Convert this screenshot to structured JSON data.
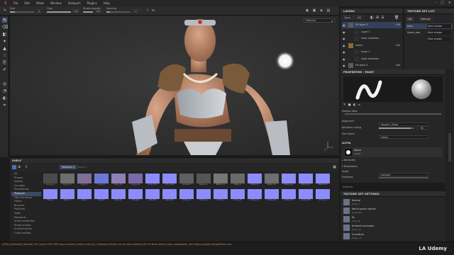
{
  "menu": {
    "items": [
      "File",
      "Edit",
      "Mode",
      "Window",
      "Viewport",
      "Plugins",
      "Help"
    ]
  },
  "toolbar": {
    "size_label": "Size",
    "size_value": "10",
    "size_fill": 0.2,
    "flow_label": "Flow",
    "flow_value": "100",
    "flow_fill": 1.0,
    "stroke_opacity_label": "Stroke opacity",
    "stroke_opacity_value": "100",
    "stroke_opacity_fill": 1.0,
    "spacing_label": "Spacing",
    "spacing_value": "15",
    "spacing_fill": 0.15
  },
  "viewport": {
    "material_mode": "Material"
  },
  "layers": {
    "title": "LAYERS",
    "blend_mode": "Norm",
    "opacity": "100",
    "rows": [
      {
        "name": "Fill layer 3",
        "value": "100"
      },
      {
        "name": "Layer 2",
        "value": ""
      },
      {
        "name": "Color selection",
        "value": ""
      },
      {
        "name": "metal",
        "value": "100"
      },
      {
        "name": "Layer 1",
        "value": ""
      },
      {
        "name": "Color selection",
        "value": ""
      },
      {
        "name": "Fill layer 3",
        "value": "100"
      }
    ]
  },
  "texture_set_list": {
    "title": "TEXTURE SET LIST",
    "tabs": [
      "All",
      "Settings"
    ],
    "rows": [
      {
        "name": "body",
        "shader": "Main shader"
      },
      {
        "name": "Sword_mat",
        "shader": "Main shader"
      },
      {
        "name": "",
        "shader": "Main shader"
      }
    ]
  },
  "properties": {
    "title": "PROPERTIES - PAINT",
    "position_jitter_label": "Position Jitter",
    "alignment_label": "Alignment",
    "alignment_value": "Tangent | Wrap",
    "backface_label": "Backface culling",
    "backface_value": "90",
    "backface_fill": 0.9,
    "size_space_label": "Size Space",
    "size_space_value": "Object",
    "alpha_section": "ALPHA",
    "alpha_name": "Alpha",
    "alpha_sub": "Shape",
    "attributes_label": "Attributes",
    "parameters_label": "Parameters",
    "angle_label": "Angle",
    "angle_value": "Isotropic",
    "hardness_label": "Hardness"
  },
  "tset_settings": {
    "title_small": "Uniforms",
    "title": "TEXTURE SET SETTINGS",
    "rows": [
      {
        "name": "Normal",
        "file": "body_d"
      },
      {
        "name": "World space normal",
        "file": "body_Wm"
      },
      {
        "name": "ID",
        "file": "body_ID"
      },
      {
        "name": "Ambient occlusion",
        "file": "body_ao"
      },
      {
        "name": "Curvature",
        "file": "body_cur"
      }
    ]
  },
  "shelf": {
    "title": "SHELF",
    "filter_chip": "Textures",
    "search_placeholder": "Search...",
    "categories": [
      "All",
      "Project",
      "Alphas",
      "Grunges",
      "Procedurals",
      "Textures",
      "Hard Surfaces",
      "Filters",
      "Brushes",
      "Particles",
      "Tools",
      "Materials",
      "Smart materials",
      "Smart masks",
      "Environments",
      "Color profiles"
    ],
    "selected_category": 5,
    "row1": [
      {
        "label": "body_ao",
        "color": "#4a4a4a"
      },
      {
        "label": "body_cur",
        "color": "#6e6e6e"
      },
      {
        "label": "body_d",
        "color": "#7f6f9a"
      },
      {
        "label": "body_ID",
        "color": "#6b78d8"
      },
      {
        "label": "body_nm",
        "color": "#8f7fb5"
      },
      {
        "label": "body_pos",
        "color": "#7a6aa8"
      },
      {
        "label": "body_Wm",
        "color": "#8c8cff"
      },
      {
        "label": "dirt_mask",
        "color": "#8c8cff"
      },
      {
        "label": "Gradient",
        "color": "#5f5f5f"
      },
      {
        "label": "Metal_ao",
        "color": "#555"
      },
      {
        "label": "Metal_cur",
        "color": "#777"
      },
      {
        "label": "Metal_d",
        "color": "#6a6a6a"
      },
      {
        "label": "Metal_ID",
        "color": "#8c8cff"
      },
      {
        "label": "Metal_nm",
        "color": "#6f6f6f"
      },
      {
        "label": "Metal_pos",
        "color": "#8c8cff"
      },
      {
        "label": "Metal_Wm",
        "color": "#8c8cff"
      },
      {
        "label": "Metal_thk",
        "color": "#8c8cff"
      }
    ],
    "row2": [
      {
        "label": "belt_ao",
        "color": "#8c8cff"
      },
      {
        "label": "belt_cur",
        "color": "#8c8cff"
      },
      {
        "label": "belt_d",
        "color": "#8c8cff"
      },
      {
        "label": "belt_ID",
        "color": "#8c8cff"
      },
      {
        "label": "belt_nm",
        "color": "#8c8cff"
      },
      {
        "label": "belt_pos",
        "color": "#8c8cff"
      },
      {
        "label": "belt_thk",
        "color": "#8c8cff"
      },
      {
        "label": "belt_Wm",
        "color": "#8c8cff"
      },
      {
        "label": "boots_ao",
        "color": "#8c8cff"
      },
      {
        "label": "boots_cur",
        "color": "#8c8cff"
      },
      {
        "label": "boots_d",
        "color": "#8c8cff"
      },
      {
        "label": "boots_ID",
        "color": "#8c8cff"
      },
      {
        "label": "boots_nm",
        "color": "#8c8cff"
      },
      {
        "label": "boots_pos",
        "color": "#8c8cff"
      },
      {
        "label": "boots_thk",
        "color": "#8c8cff"
      },
      {
        "label": "boots_Wm",
        "color": "#8c8cff"
      },
      {
        "label": "armor_d",
        "color": "#8c8cff"
      }
    ]
  },
  "statusbar": {
    "message": "[GPU] [Hardware] [Texture] The current TDR (GPU hang recovery) delay is low (2s). Substance Painter can be interrupted by the OS when doing a long computation. See https://support.allegorithmic.com",
    "watermark": "LA Udemy"
  },
  "colors": {
    "accent": "#3d4a66",
    "thumb_blue": "#8c8cff",
    "status_warning": "#e07a55"
  }
}
